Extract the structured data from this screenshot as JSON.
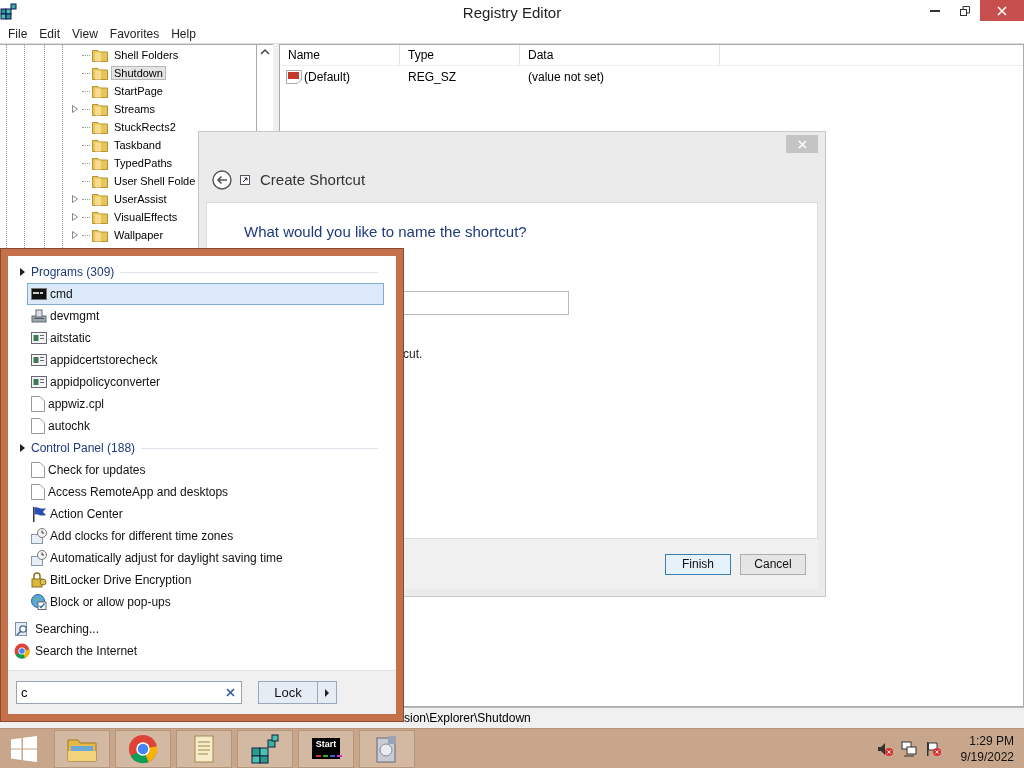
{
  "window": {
    "title": "Registry Editor",
    "menu": [
      "File",
      "Edit",
      "View",
      "Favorites",
      "Help"
    ]
  },
  "tree": {
    "items": [
      {
        "label": "Shell Folders",
        "expandable": false,
        "selected": false
      },
      {
        "label": "Shutdown",
        "expandable": false,
        "selected": true
      },
      {
        "label": "StartPage",
        "expandable": false,
        "selected": false
      },
      {
        "label": "Streams",
        "expandable": true,
        "selected": false
      },
      {
        "label": "StuckRects2",
        "expandable": false,
        "selected": false
      },
      {
        "label": "Taskband",
        "expandable": false,
        "selected": false
      },
      {
        "label": "TypedPaths",
        "expandable": false,
        "selected": false
      },
      {
        "label": "User Shell Folde",
        "expandable": false,
        "selected": false
      },
      {
        "label": "UserAssist",
        "expandable": true,
        "selected": false
      },
      {
        "label": "VisualEffects",
        "expandable": true,
        "selected": false
      },
      {
        "label": "Wallpaper",
        "expandable": true,
        "selected": false
      }
    ]
  },
  "values": {
    "columns": [
      "Name",
      "Type",
      "Data"
    ],
    "rows": [
      {
        "name": "(Default)",
        "type": "REG_SZ",
        "data": "(value not set)"
      }
    ]
  },
  "status_bar": "sion\\Explorer\\Shutdown",
  "dialog": {
    "title": "Create Shortcut",
    "heading": "What would you like to name the shortcut?",
    "hint_tail": "cut.",
    "buttons": [
      {
        "label": "Finish",
        "default": true
      },
      {
        "label": "Cancel",
        "default": false
      }
    ]
  },
  "start_menu": {
    "groups": [
      {
        "title": "Programs (309)",
        "items": [
          {
            "label": "cmd",
            "kind": "console",
            "selected": true
          },
          {
            "label": "devmgmt",
            "kind": "device",
            "selected": false
          },
          {
            "label": "aitstatic",
            "kind": "window",
            "selected": false
          },
          {
            "label": "appidcertstorecheck",
            "kind": "window",
            "selected": false
          },
          {
            "label": "appidpolicyconverter",
            "kind": "window",
            "selected": false
          },
          {
            "label": "appwiz.cpl",
            "kind": "document",
            "selected": false
          },
          {
            "label": "autochk",
            "kind": "document",
            "selected": false
          }
        ]
      },
      {
        "title": "Control Panel (188)",
        "items": [
          {
            "label": "Check for updates",
            "kind": "document",
            "selected": false
          },
          {
            "label": "Access RemoteApp and desktops",
            "kind": "document",
            "selected": false
          },
          {
            "label": "Action Center",
            "kind": "flag",
            "selected": false
          },
          {
            "label": "Add clocks for different time zones",
            "kind": "clock",
            "selected": false
          },
          {
            "label": "Automatically adjust for daylight saving time",
            "kind": "clock",
            "selected": false
          },
          {
            "label": "BitLocker Drive Encryption",
            "kind": "key",
            "selected": false
          },
          {
            "label": "Block or allow pop-ups",
            "kind": "globe",
            "selected": false
          }
        ]
      }
    ],
    "footer": [
      {
        "label": "Searching...",
        "kind": "search"
      },
      {
        "label": "Search the Internet",
        "kind": "browser"
      }
    ],
    "search": {
      "value": "c"
    },
    "power_button": {
      "label": "Lock"
    }
  },
  "taskbar": {
    "apps": [
      {
        "kind": "folder"
      },
      {
        "kind": "browser"
      },
      {
        "kind": "scroll"
      },
      {
        "kind": "cubes"
      },
      {
        "kind": "start",
        "label": "Start"
      },
      {
        "kind": "disk"
      }
    ],
    "clock": {
      "time": "1:29 PM",
      "date": "9/19/2022"
    }
  }
}
